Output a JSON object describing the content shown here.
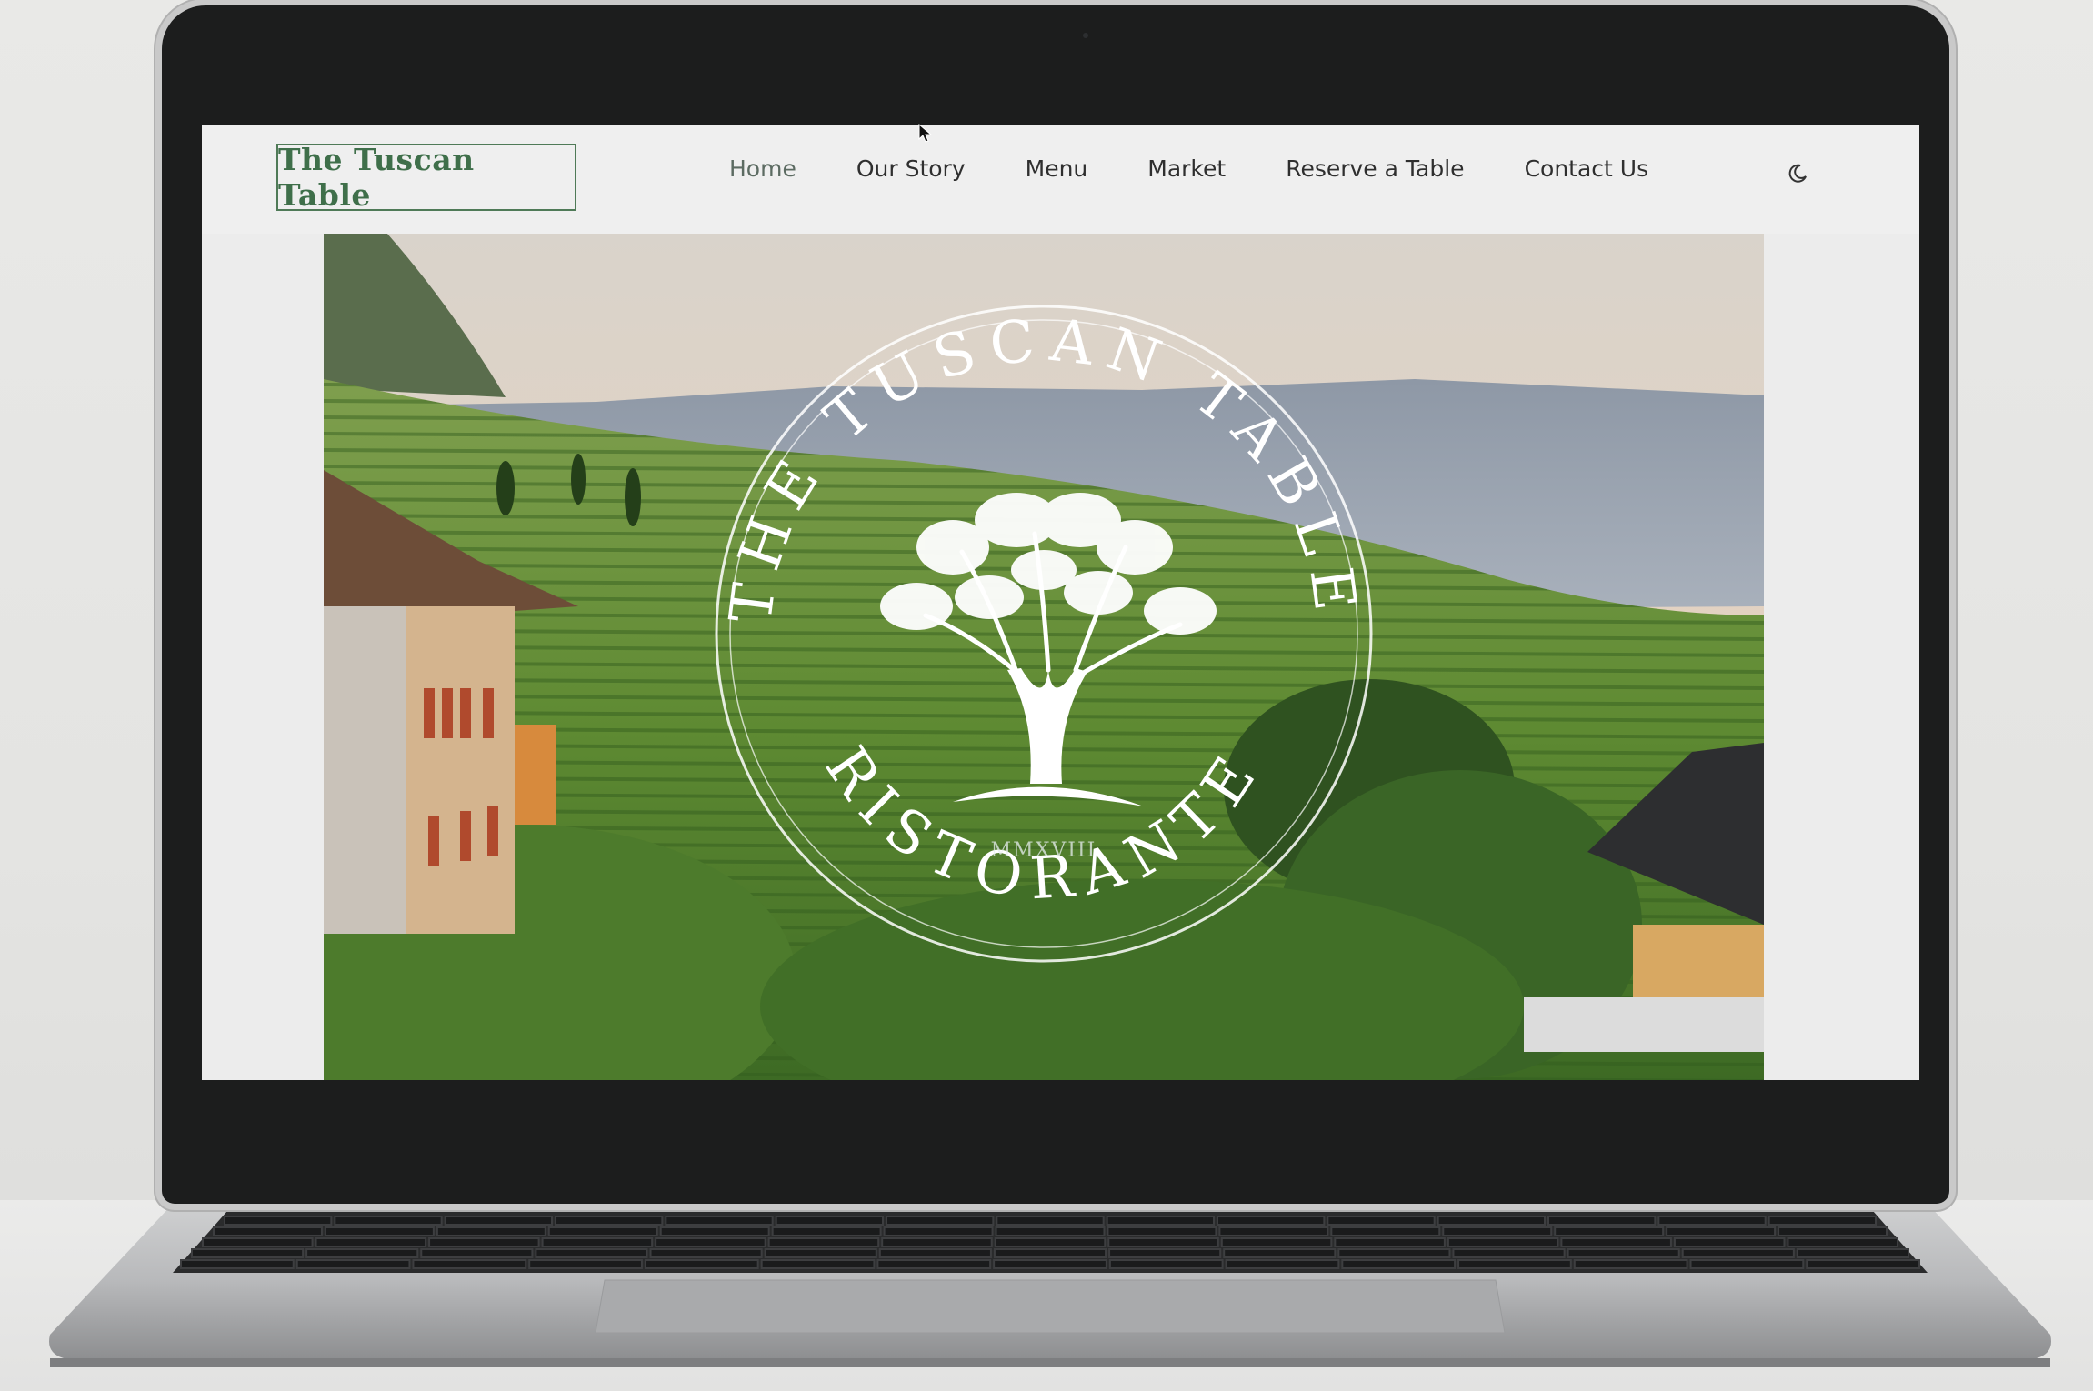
{
  "site": {
    "logo_text": "The Tuscan Table",
    "nav": [
      {
        "label": "Home",
        "active": true
      },
      {
        "label": "Our Story",
        "active": false
      },
      {
        "label": "Menu",
        "active": false
      },
      {
        "label": "Market",
        "active": false
      },
      {
        "label": "Reserve a Table",
        "active": false
      },
      {
        "label": "Contact Us",
        "active": false
      }
    ],
    "theme_toggle_icon": "moon-icon"
  },
  "hero": {
    "emblem_top_text": "THE TUSCAN TABLE",
    "emblem_bottom_text": "RISTORANTE",
    "emblem_year": "MMXVIII",
    "emblem_icon": "olive-tree-icon"
  },
  "colors": {
    "brand_green": "#3f6f4a",
    "nav_text": "#2f2f2f",
    "page_bg": "#efefef"
  }
}
